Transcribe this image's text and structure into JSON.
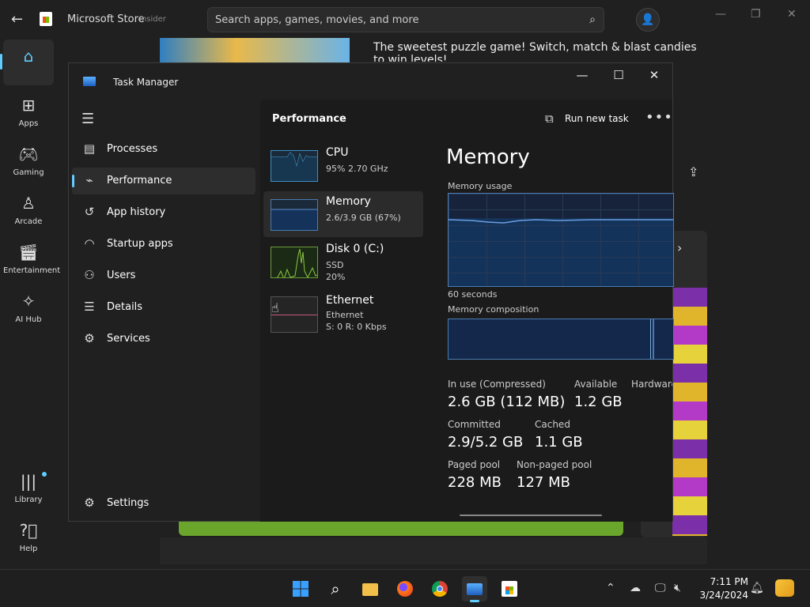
{
  "store": {
    "title": "Microsoft Store",
    "badge": "Insider",
    "search_placeholder": "Search apps, games, movies, and more",
    "description": "The sweetest puzzle game! Switch, match & blast candies to win levels!",
    "nav": [
      {
        "label": "",
        "icon": "home-icon"
      },
      {
        "label": "Apps",
        "icon": "apps-icon"
      },
      {
        "label": "Gaming",
        "icon": "gamepad-icon"
      },
      {
        "label": "Arcade",
        "icon": "joystick-icon"
      },
      {
        "label": "Entertainment",
        "icon": "clapper-icon"
      },
      {
        "label": "AI Hub",
        "icon": "sparkle-icon"
      },
      {
        "label": "Library",
        "icon": "library-icon"
      },
      {
        "label": "Help",
        "icon": "help-icon"
      }
    ]
  },
  "taskmanager": {
    "title": "Task Manager",
    "nav": [
      {
        "label": "Processes",
        "icon": "processes-icon"
      },
      {
        "label": "Performance",
        "icon": "performance-icon"
      },
      {
        "label": "App history",
        "icon": "history-icon"
      },
      {
        "label": "Startup apps",
        "icon": "startup-icon"
      },
      {
        "label": "Users",
        "icon": "users-icon"
      },
      {
        "label": "Details",
        "icon": "details-icon"
      },
      {
        "label": "Services",
        "icon": "services-icon"
      }
    ],
    "settings_label": "Settings",
    "page_title": "Performance",
    "run_new_task": "Run new task",
    "resources": [
      {
        "name": "CPU",
        "line1": "95%  2.70 GHz",
        "line2": ""
      },
      {
        "name": "Memory",
        "line1": "2.6/3.9 GB (67%)",
        "line2": ""
      },
      {
        "name": "Disk 0 (C:)",
        "line1": "SSD",
        "line2": "20%"
      },
      {
        "name": "Ethernet",
        "line1": "Ethernet",
        "line2": "S: 0  R: 0 Kbps"
      }
    ],
    "detail": {
      "heading": "Memory",
      "usage_label": "Memory usage",
      "time_label": "60 seconds",
      "composition_label": "Memory composition",
      "stats": {
        "in_use_label": "In use (Compressed)",
        "in_use_value": "2.6 GB (112 MB)",
        "available_label": "Available",
        "available_value": "1.2 GB",
        "hardware_label": "Hardware",
        "committed_label": "Committed",
        "committed_value": "2.9/5.2 GB",
        "cached_label": "Cached",
        "cached_value": "1.1 GB",
        "paged_label": "Paged pool",
        "paged_value": "228 MB",
        "nonpaged_label": "Non-paged pool",
        "nonpaged_value": "127 MB"
      }
    }
  },
  "taskbar": {
    "time": "7:11 PM",
    "date": "3/24/2024"
  },
  "colors": {
    "accent": "#60cdff",
    "graph_border": "#4a7bb0",
    "graph_fill": "#13335a"
  }
}
